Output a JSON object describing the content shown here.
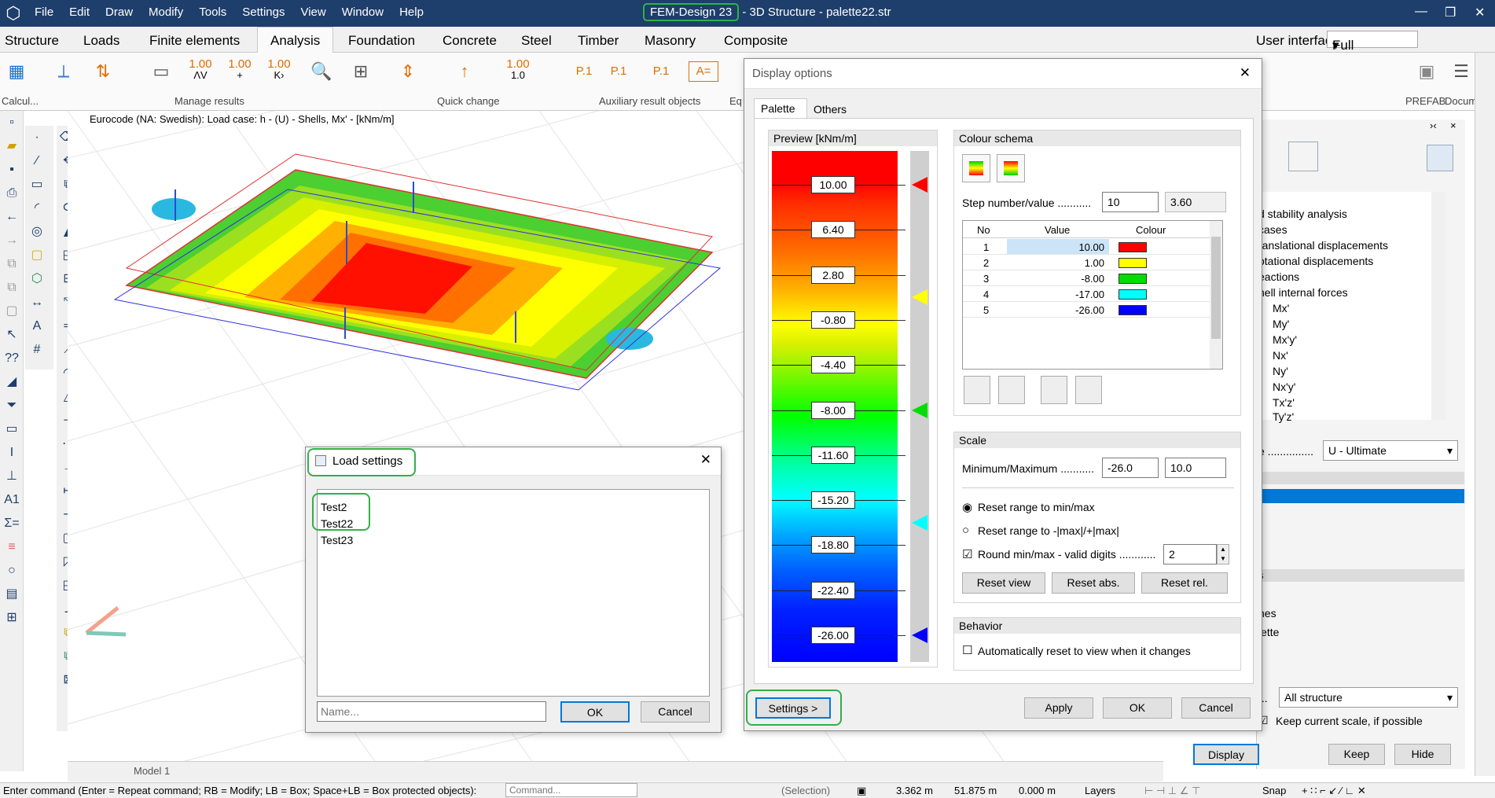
{
  "app": {
    "menu": [
      "File",
      "Edit",
      "Draw",
      "Modify",
      "Tools",
      "Settings",
      "View",
      "Window",
      "Help"
    ],
    "title_highlight": "FEM-Design 23",
    "title_rest": " - 3D Structure - palette22.str"
  },
  "ribbon": {
    "tabs": [
      "Structure",
      "Loads",
      "Finite elements",
      "Analysis",
      "Foundation",
      "Concrete",
      "Steel",
      "Timber",
      "Masonry",
      "Composite"
    ],
    "ui_label": "User interface:",
    "ui_value": "Full",
    "groups": [
      "Calcul...",
      "Manage results",
      "Quick change",
      "Auxiliary result objects",
      "Eq",
      "PREFAB",
      "Docum..."
    ],
    "num_icons": [
      "1.00",
      "1.00",
      "1.00",
      "1.00",
      "1.0",
      "P.1",
      "P.1",
      "P.1",
      "A="
    ]
  },
  "view": {
    "title": "Eurocode (NA: Swedish): Load case: h - (U) - Shells, Mx' - [kNm/m]",
    "model_tab": "Model 1"
  },
  "right_panel": {
    "tree": [
      "d stability analysis",
      "cases",
      "ranslational displacements",
      "otational displacements",
      "eactions",
      "hell internal forces",
      "Mx'",
      "My'",
      "Mx'y'",
      "Nx'",
      "Ny'",
      "Nx'y'",
      "Tx'z'",
      "Ty'z'"
    ],
    "combo_prefix": "e ...............",
    "combo_value": "U - Ultimate",
    "section_s": "s",
    "item_nes": "nes",
    "item_lette": "lette",
    "scope_prefix": "...",
    "scope_value": "All structure",
    "keep_scale_label": "Keep current scale, if possible",
    "buttons": {
      "display": "Display",
      "keep": "Keep",
      "hide": "Hide"
    }
  },
  "display_options": {
    "title": "Display options",
    "tabs": {
      "palette": "Palette",
      "others": "Others"
    },
    "preview_label": "Preview [kNm/m]",
    "preview_values": [
      "10.00",
      "6.40",
      "2.80",
      "-0.80",
      "-4.40",
      "-8.00",
      "-11.60",
      "-15.20",
      "-18.80",
      "-22.40",
      "-26.00"
    ],
    "colour_schema_label": "Colour schema",
    "step_label": "Step number/value ...........",
    "step_number": "10",
    "step_value": "3.60",
    "table_headers": {
      "no": "No",
      "value": "Value",
      "colour": "Colour"
    },
    "rows": [
      {
        "no": "1",
        "value": "10.00",
        "color": "#ff0000"
      },
      {
        "no": "2",
        "value": "1.00",
        "color": "#ffff00"
      },
      {
        "no": "3",
        "value": "-8.00",
        "color": "#00dd00"
      },
      {
        "no": "4",
        "value": "-17.00",
        "color": "#00ffff"
      },
      {
        "no": "5",
        "value": "-26.00",
        "color": "#0000ff"
      }
    ],
    "scale_label": "Scale",
    "minmax_label": "Minimum/Maximum ...........",
    "min": "-26.0",
    "max": "10.0",
    "radio_minmax": "Reset range to min/max",
    "radio_abs": "Reset range to -|max|/+|max|",
    "round_label": "Round min/max - valid digits ............",
    "round_digits": "2",
    "buttons": {
      "reset_view": "Reset view",
      "reset_abs": "Reset abs.",
      "reset_rel": "Reset rel.",
      "settings": "Settings >",
      "apply": "Apply",
      "ok": "OK",
      "cancel": "Cancel"
    },
    "behavior_label": "Behavior",
    "auto_reset_label": "Automatically reset to view when it changes"
  },
  "load_settings": {
    "title": "Load settings",
    "items": [
      "Test2",
      "Test22",
      "Test23"
    ],
    "name_placeholder": "Name...",
    "ok": "OK",
    "cancel": "Cancel"
  },
  "status": {
    "command_hint": "Enter command (Enter = Repeat command; RB = Modify; LB = Box; Space+LB = Box protected objects):",
    "command_placeholder": "Command...",
    "selection": "(Selection)",
    "x": "3.362 m",
    "y": "51.875 m",
    "z": "0.000 m",
    "layers": "Layers",
    "snap": "Snap"
  }
}
